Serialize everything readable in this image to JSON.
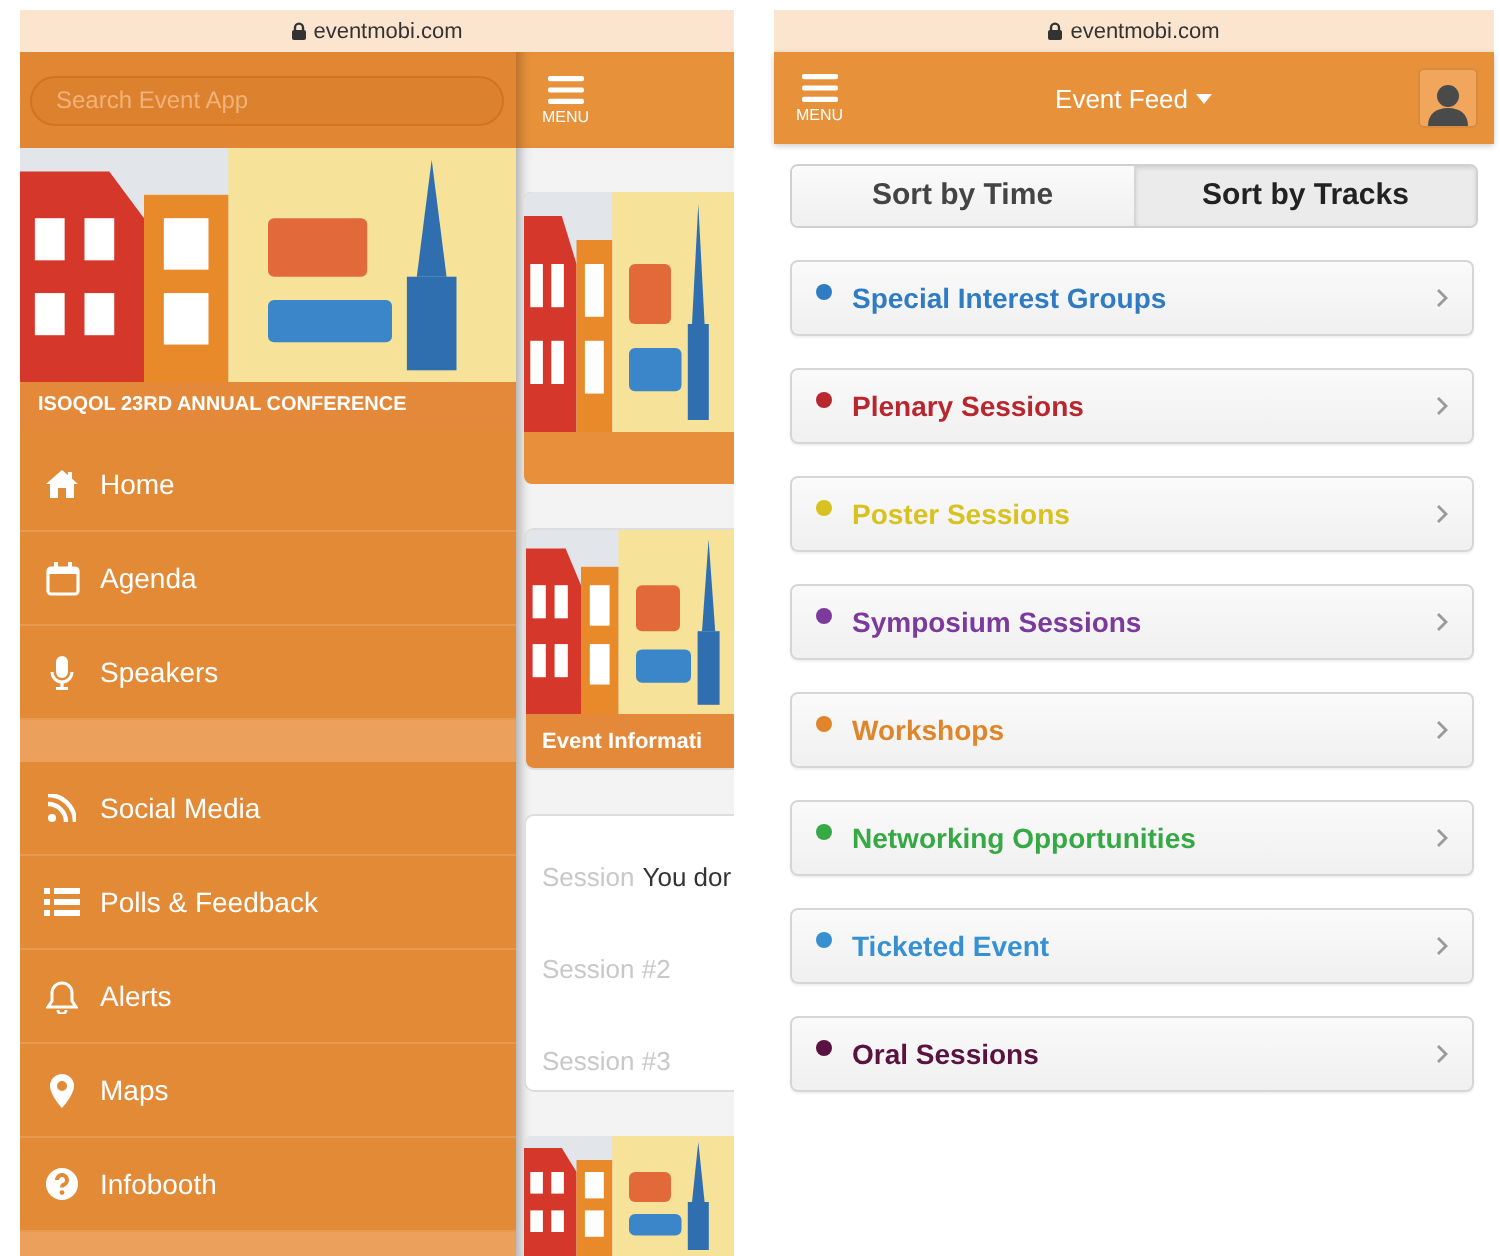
{
  "left_screen": {
    "url": "eventmobi.com",
    "search": {
      "placeholder": "Search Event App"
    },
    "menu_button": "MENU",
    "conference_title": "ISOQOL 23RD ANNUAL CONFERENCE",
    "menu_groups": [
      {
        "items": [
          {
            "label": "Home"
          },
          {
            "label": "Agenda"
          },
          {
            "label": "Speakers"
          }
        ]
      },
      {
        "items": [
          {
            "label": "Social Media"
          },
          {
            "label": "Polls & Feedback"
          },
          {
            "label": "Alerts"
          },
          {
            "label": "Maps"
          },
          {
            "label": "Infobooth"
          }
        ]
      }
    ],
    "feed_behind": {
      "event_card_label": "Event Informati",
      "sessions": [
        {
          "title": "Session",
          "note": "You dor"
        },
        {
          "title": "Session #2"
        },
        {
          "title": "Session #3"
        }
      ]
    }
  },
  "right_screen": {
    "url": "eventmobi.com",
    "menu_button": "MENU",
    "title": "Event Feed",
    "sort_tabs": [
      {
        "label": "Sort by Time",
        "selected": false
      },
      {
        "label": "Sort by Tracks",
        "selected": true
      }
    ],
    "tracks": [
      {
        "label": "Special Interest Groups",
        "color": "#2f7cc4"
      },
      {
        "label": "Plenary Sessions",
        "color": "#b8262e"
      },
      {
        "label": "Poster Sessions",
        "color": "#d8c21f"
      },
      {
        "label": "Symposium Sessions",
        "color": "#7b3a9c"
      },
      {
        "label": "Workshops",
        "color": "#e0862a"
      },
      {
        "label": "Networking Opportunities",
        "color": "#36a845"
      },
      {
        "label": "Ticketed Event",
        "color": "#3690d2"
      },
      {
        "label": "Oral Sessions",
        "color": "#5a1240"
      }
    ]
  }
}
